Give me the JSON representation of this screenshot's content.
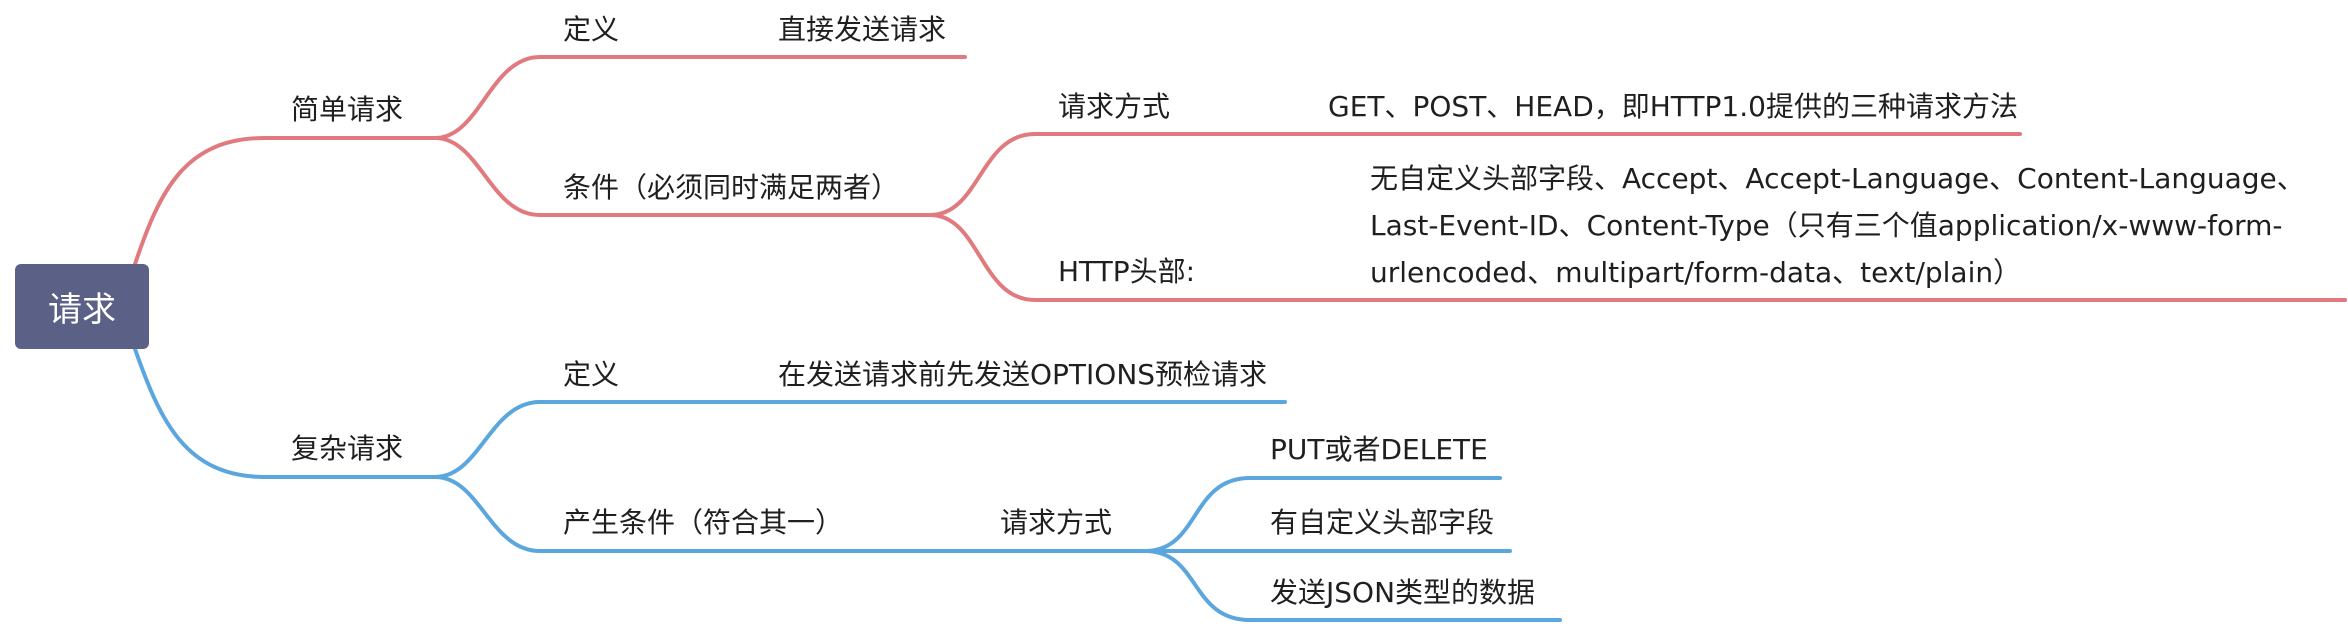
{
  "colors": {
    "root_bg": "#5b6087",
    "red_branch": "#e07a7e",
    "blue_branch": "#5aa6dd",
    "text": "#1f1f1f"
  },
  "root": {
    "label": "请求"
  },
  "branches": {
    "simple": {
      "label": "简单请求",
      "definition": {
        "label": "定义",
        "value": "直接发送请求"
      },
      "conditions": {
        "label": "条件（必须同时满足两者）",
        "method": {
          "label": "请求方式",
          "value": "GET、POST、HEAD，即HTTP1.0提供的三种请求方法"
        },
        "headers": {
          "label": "HTTP头部:",
          "value_lines": [
            "无自定义头部字段、Accept、Accept-Language、Content-Language、",
            "Last-Event-ID、Content-Type（只有三个值application/x-www-form-",
            "urlencoded、multipart/form-data、text/plain）"
          ]
        }
      }
    },
    "complex": {
      "label": "复杂请求",
      "definition": {
        "label": "定义",
        "value": "在发送请求前先发送OPTIONS预检请求"
      },
      "conditions": {
        "label": "产生条件（符合其一）",
        "method": {
          "label": "请求方式",
          "items": [
            "PUT或者DELETE",
            "有自定义头部字段",
            "发送JSON类型的数据"
          ]
        }
      }
    }
  }
}
